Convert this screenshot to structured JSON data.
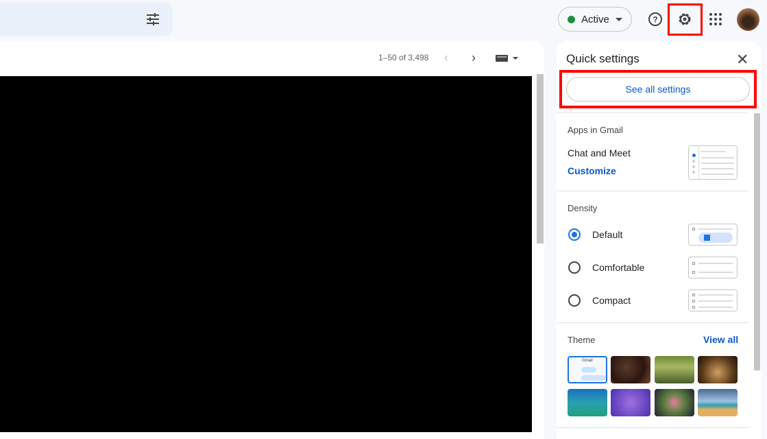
{
  "header": {
    "status_label": "Active",
    "status_color": "#1e8e3e"
  },
  "mail": {
    "pagination": "1–50 of 3,498"
  },
  "quick_settings": {
    "title": "Quick settings",
    "see_all": "See all settings",
    "apps_section": "Apps in Gmail",
    "chat_meet": "Chat and Meet",
    "customize": "Customize",
    "density_section": "Density",
    "density_options": [
      {
        "label": "Default",
        "selected": true
      },
      {
        "label": "Comfortable",
        "selected": false
      },
      {
        "label": "Compact",
        "selected": false
      }
    ],
    "theme_section": "Theme",
    "view_all": "View all",
    "theme_preview_label": "Gmail"
  },
  "accent": "#0b57d0"
}
